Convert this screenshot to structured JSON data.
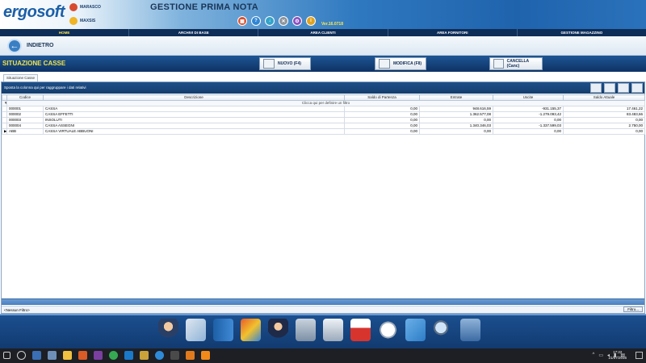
{
  "header": {
    "logo": "ergosoft",
    "app_title": "GESTIONE PRIMA NOTA",
    "version": "Ver.16.0718",
    "users": [
      {
        "name": "MARASCO"
      },
      {
        "name": "MAXSIS"
      }
    ],
    "tool_icons": [
      "calculator-icon",
      "help-icon",
      "download-icon",
      "close-icon",
      "settings-icon",
      "info-icon"
    ]
  },
  "menu": {
    "items": [
      {
        "label": "HOME",
        "active": true
      },
      {
        "label": "ARCHIVI DI BASE"
      },
      {
        "label": "AREA CLIENTI"
      },
      {
        "label": "AREA FORNITORI"
      },
      {
        "label": "GESTIONE MAGAZZINO"
      }
    ]
  },
  "nav": {
    "back_label": "INDIETRO"
  },
  "section": {
    "title": "SITUAZIONE CASSE",
    "buttons": [
      {
        "label": "NUOVO (F4)",
        "icon": "new-document-icon"
      },
      {
        "label": "MODIFICA (F8)",
        "icon": "edit-document-icon"
      },
      {
        "label": "CANCELLA (Canc)",
        "icon": "delete-document-icon"
      }
    ]
  },
  "tab": {
    "label": "Situazione Casse"
  },
  "grid": {
    "group_hint": "Sposta la colonna qui per raggruppare i dati relativi",
    "filter_hint": "Clicca qui per definire un filtro",
    "columns": [
      "Codice",
      "Descrizione",
      "Saldo di Partenza",
      "Entrate",
      "Uscite",
      "Saldo Attuale"
    ],
    "rows": [
      {
        "codice": "000001",
        "descrizione": "CASSA",
        "saldo_partenza": "0,00",
        "entrate": "948.616,59",
        "uscite": "-931.155,37",
        "saldo_attuale": "17.461,22"
      },
      {
        "codice": "000002",
        "descrizione": "CASSA EFFETTI",
        "saldo_partenza": "0,00",
        "entrate": "1.362.577,08",
        "uscite": "-1.279.093,42",
        "saldo_attuale": "83.483,66"
      },
      {
        "codice": "000003",
        "descrizione": "INSOLUTI",
        "saldo_partenza": "0,00",
        "entrate": "0,00",
        "uscite": "0,00",
        "saldo_attuale": "0,00"
      },
      {
        "codice": "000004",
        "descrizione": "CASSA ASSEGNI",
        "saldo_partenza": "0,00",
        "entrate": "1.340.346,03",
        "uscite": "-1.337.599,03",
        "saldo_attuale": "2.750,00"
      },
      {
        "codice": "ABB",
        "descrizione": "CASSA VIRTUALE ABBUONI",
        "saldo_partenza": "0,00",
        "entrate": "0,00",
        "uscite": "0,00",
        "saldo_attuale": "0,00"
      }
    ],
    "status_text": "<Nessun Filtro>",
    "filter_button": "Filtro..."
  },
  "taskbar": {
    "time": "17:22",
    "date": "21/07/2016"
  },
  "colors": {
    "menu_bg": "#0e2d57",
    "section_title": "#f1e34a",
    "accent": "#1e5694"
  }
}
